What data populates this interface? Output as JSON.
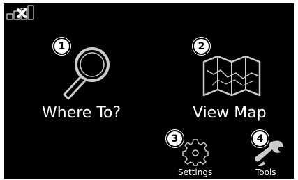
{
  "menu": {
    "where_to": {
      "label": "Where To?",
      "icon": "magnifier-icon",
      "callout": "1"
    },
    "view_map": {
      "label": "View Map",
      "icon": "folded-map-icon",
      "callout": "2"
    },
    "settings": {
      "label": "Settings",
      "icon": "gear-icon",
      "callout": "3"
    },
    "tools": {
      "label": "Tools",
      "icon": "wrench-icon",
      "callout": "4"
    }
  },
  "status_bar": {
    "signal_icon": "no-gps-signal-icon"
  },
  "colors": {
    "background": "#000000",
    "foreground": "#ffffff",
    "icon": "#cccccc"
  }
}
